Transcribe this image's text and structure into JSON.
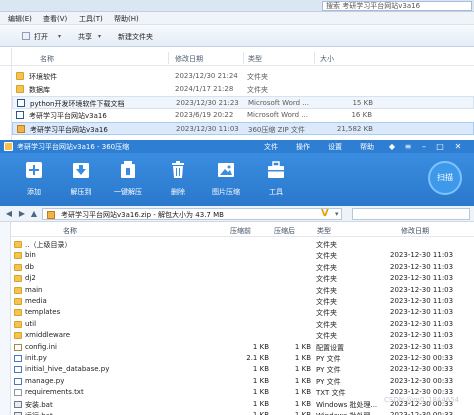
{
  "explorer": {
    "search_placeholder": "搜索 考研学习平台网站v3a16",
    "menu": [
      "编辑(E)",
      "查看(V)",
      "工具(T)",
      "帮助(H)"
    ],
    "toolbar": {
      "open": "打开",
      "share": "共享",
      "new_folder": "新建文件夹"
    },
    "columns": {
      "name": "名称",
      "date": "修改日期",
      "type": "类型",
      "size": "大小"
    },
    "rows": [
      {
        "name": "环境软件",
        "date": "2023/12/30 21:24",
        "type": "文件夹",
        "size": "",
        "icon": "folder-icon"
      },
      {
        "name": "数据库",
        "date": "2024/1/17 21:28",
        "type": "文件夹",
        "size": "",
        "icon": "folder-icon"
      },
      {
        "name": "python开发环境软件下载文档",
        "date": "2023/12/30 21:23",
        "type": "Microsoft Word ...",
        "size": "15 KB",
        "icon": "word-doc-icon"
      },
      {
        "name": "考研学习平台网站v3a16",
        "date": "2023/6/19 20:22",
        "type": "Microsoft Word ...",
        "size": "16 KB",
        "icon": "word-doc-icon"
      },
      {
        "name": "考研学习平台网站v3a16",
        "date": "2023/12/30 11:03",
        "type": "360压缩 ZIP 文件",
        "size": "21,582 KB",
        "icon": "zip-icon"
      }
    ]
  },
  "zip": {
    "title": "考研学习平台网站v3a16 - 360压缩",
    "menu": [
      "文件",
      "操作",
      "设置",
      "帮助"
    ],
    "tools": [
      "添加",
      "解压到",
      "一键解压",
      "删除",
      "图片压缩",
      "工具"
    ],
    "scan": "扫描",
    "address": "考研学习平台网站v3a16.zip - 解包大小为 43.7 MB",
    "columns": {
      "name": "名称",
      "size": "压缩前",
      "compressed": "压缩后",
      "type": "类型",
      "date": "修改日期"
    },
    "rows": [
      {
        "name": "..（上级目录）",
        "size": "",
        "compressed": "",
        "type": "文件夹",
        "date": "",
        "kind": "up"
      },
      {
        "name": "bin",
        "size": "",
        "compressed": "",
        "type": "文件夹",
        "date": "2023-12-30 11:03",
        "kind": "folder"
      },
      {
        "name": "db",
        "size": "",
        "compressed": "",
        "type": "文件夹",
        "date": "2023-12-30 11:03",
        "kind": "folder"
      },
      {
        "name": "dj2",
        "size": "",
        "compressed": "",
        "type": "文件夹",
        "date": "2023-12-30 11:03",
        "kind": "folder"
      },
      {
        "name": "main",
        "size": "",
        "compressed": "",
        "type": "文件夹",
        "date": "2023-12-30 11:03",
        "kind": "folder"
      },
      {
        "name": "media",
        "size": "",
        "compressed": "",
        "type": "文件夹",
        "date": "2023-12-30 11:03",
        "kind": "folder"
      },
      {
        "name": "templates",
        "size": "",
        "compressed": "",
        "type": "文件夹",
        "date": "2023-12-30 11:03",
        "kind": "folder"
      },
      {
        "name": "util",
        "size": "",
        "compressed": "",
        "type": "文件夹",
        "date": "2023-12-30 11:03",
        "kind": "folder"
      },
      {
        "name": "xmiddleware",
        "size": "",
        "compressed": "",
        "type": "文件夹",
        "date": "2023-12-30 11:03",
        "kind": "folder"
      },
      {
        "name": "config.ini",
        "size": "1 KB",
        "compressed": "1 KB",
        "type": "配置设置",
        "date": "2023-12-30 11:03",
        "kind": "ini"
      },
      {
        "name": "init.py",
        "size": "2.1 KB",
        "compressed": "1 KB",
        "type": "PY 文件",
        "date": "2023-12-30 00:33",
        "kind": "py"
      },
      {
        "name": "initial_hive_database.py",
        "size": "1 KB",
        "compressed": "1 KB",
        "type": "PY 文件",
        "date": "2023-12-30 00:33",
        "kind": "py"
      },
      {
        "name": "manage.py",
        "size": "1 KB",
        "compressed": "1 KB",
        "type": "PY 文件",
        "date": "2023-12-30 00:33",
        "kind": "py"
      },
      {
        "name": "requirements.txt",
        "size": "1 KB",
        "compressed": "1 KB",
        "type": "TXT 文件",
        "date": "2023-12-30 00:33",
        "kind": "txt"
      },
      {
        "name": "安装.bat",
        "size": "1 KB",
        "compressed": "1 KB",
        "type": "Windows 批处理...",
        "date": "2023-12-30 00:33",
        "kind": "bat"
      },
      {
        "name": "运行.bat",
        "size": "1 KB",
        "compressed": "1 KB",
        "type": "Windows 批处理...",
        "date": "2023-12-30 00:33",
        "kind": "bat"
      }
    ]
  },
  "watermark": "CSDN @m0_1844654",
  "colors": {
    "title_blue": "#2e7fd3",
    "toolbar_blue": "#3a8de0",
    "folder_yellow": "#f3c451"
  }
}
